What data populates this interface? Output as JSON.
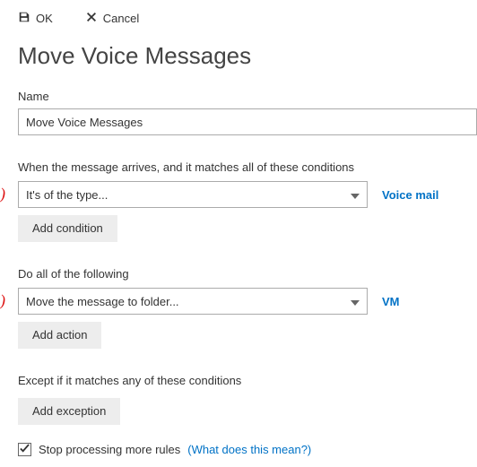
{
  "toolbar": {
    "ok_label": "OK",
    "cancel_label": "Cancel"
  },
  "page_title": "Move Voice Messages",
  "name_field": {
    "label": "Name",
    "value": "Move Voice Messages"
  },
  "conditions": {
    "heading": "When the message arrives, and it matches all of these conditions",
    "select_value": "It's of the type...",
    "link_text": "Voice mail",
    "add_button": "Add condition"
  },
  "actions": {
    "heading": "Do all of the following",
    "select_value": "Move the message to folder...",
    "link_text": "VM",
    "add_button": "Add action"
  },
  "exceptions": {
    "heading": "Except if it matches any of these conditions",
    "add_button": "Add exception"
  },
  "stop_processing": {
    "label": "Stop processing more rules",
    "help_text": "(What does this mean?)"
  }
}
